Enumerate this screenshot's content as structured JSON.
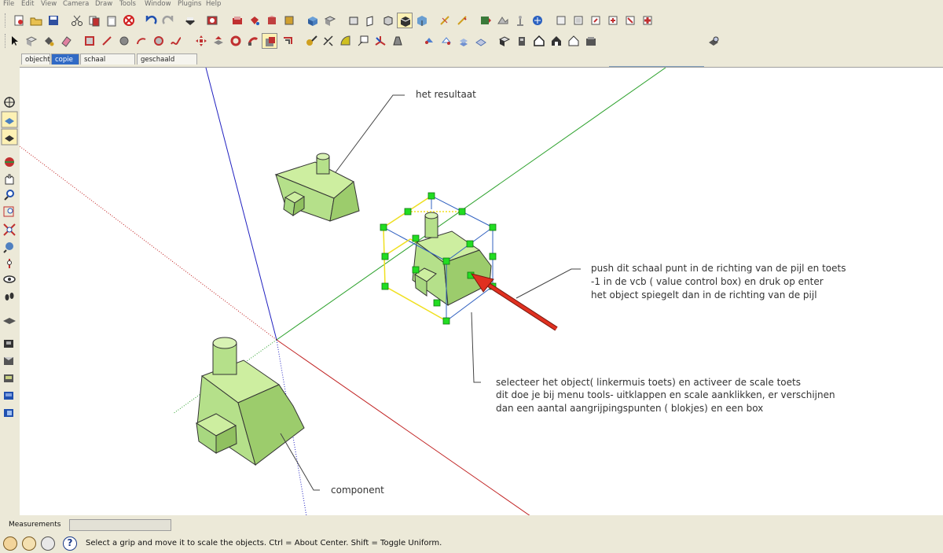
{
  "menu": [
    "File",
    "Edit",
    "View",
    "Camera",
    "Draw",
    "Tools",
    "Window",
    "Plugins",
    "Help"
  ],
  "scene_tabs": [
    {
      "label": "objecht",
      "active": false
    },
    {
      "label": "copie",
      "active": true
    },
    {
      "label": "schaal opdracht",
      "active": false
    },
    {
      "label": "geschaald object",
      "active": false
    }
  ],
  "toolbar_combo": {
    "value": ""
  },
  "annotations": {
    "resultaat": "het resultaat",
    "push": [
      "push dit schaal punt in de richting van de pijl en toets",
      "-1 in de vcb ( value control box) en druk op enter",
      "het object spiegelt dan in de richting van de pijl"
    ],
    "select": [
      "selecteer het object( linkermuis toets) en activeer de scale toets",
      "dit doe je bij menu tools- uitklappen en scale aanklikken, er verschijnen",
      "dan een aantal aangrijpingspunten ( blokjes) en een box"
    ],
    "component": "component"
  },
  "measurements": {
    "label": "Measurements",
    "value": ""
  },
  "status": {
    "text": "Select a grip and move it to scale the objects. Ctrl = About Center. Shift = Toggle Uniform."
  },
  "status_icons": [
    "geo-location-icon",
    "credits-icon",
    "google-sign-in-icon",
    "help-icon"
  ],
  "colors": {
    "axis_blue": "#2020c0",
    "axis_green": "#2aa02a",
    "axis_red": "#c02020",
    "model_fill": "#b5e08a",
    "grip_green": "#22dd22",
    "bbox_yellow": "#f0e020",
    "arrow_red": "#e03020"
  }
}
